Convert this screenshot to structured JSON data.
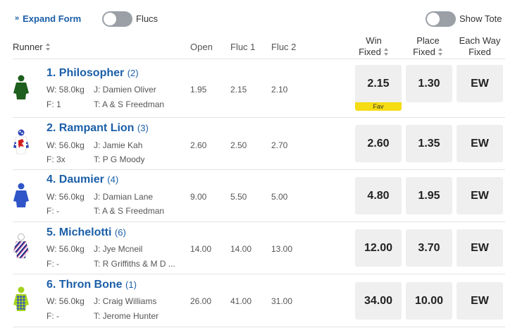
{
  "controls": {
    "expand_label": "Expand Form",
    "expand_icon": "double-chevron-down",
    "flucs_label": "Flucs",
    "flucs_on": false,
    "show_tote_label": "Show Tote",
    "show_tote_on": false
  },
  "header": {
    "runner": "Runner",
    "open": "Open",
    "fluc1": "Fluc 1",
    "fluc2": "Fluc 2",
    "win_line1": "Win",
    "win_line2": "Fixed",
    "place_line1": "Place",
    "place_line2": "Fixed",
    "ew_line1": "Each Way",
    "ew_line2": "Fixed"
  },
  "runners": [
    {
      "name": "1. Philosopher",
      "barrier": "(2)",
      "weight": "W: 58.0kg",
      "jockey": "J: Damien Oliver",
      "form": "F: 1",
      "trainer": "T: A & S Freedman",
      "open": "1.95",
      "fluc1": "2.15",
      "fluc2": "2.10",
      "win": "2.15",
      "place": "1.30",
      "ew": "EW",
      "fav": "Fav",
      "silk_colors": [
        "#1e5e1e",
        "#1e5e1e"
      ]
    },
    {
      "name": "2. Rampant Lion",
      "barrier": "(3)",
      "weight": "W: 56.0kg",
      "jockey": "J: Jamie Kah",
      "form": "F: 3x",
      "trainer": "T: P G Moody",
      "open": "2.60",
      "fluc1": "2.50",
      "fluc2": "2.70",
      "win": "2.60",
      "place": "1.35",
      "ew": "EW",
      "silk_colors": [
        "#2b45b8",
        "#ffffff",
        "#d01f1f"
      ]
    },
    {
      "name": "4. Daumier",
      "barrier": "(4)",
      "weight": "W: 56.0kg",
      "jockey": "J: Damian Lane",
      "form": "F: -",
      "trainer": "T: A & S Freedman",
      "open": "9.00",
      "fluc1": "5.50",
      "fluc2": "5.00",
      "win": "4.80",
      "place": "1.95",
      "ew": "EW",
      "silk_colors": [
        "#2f55c8",
        "#2f55c8"
      ]
    },
    {
      "name": "5. Michelotti",
      "barrier": "(6)",
      "weight": "W: 56.0kg",
      "jockey": "J: Jye Mcneil",
      "form": "F: -",
      "trainer": "T: R Griffiths & M D ...",
      "open": "14.00",
      "fluc1": "14.00",
      "fluc2": "13.00",
      "win": "12.00",
      "place": "3.70",
      "ew": "EW",
      "silk_colors": [
        "#ffffff",
        "#1c2f86",
        "#e06aa8"
      ]
    },
    {
      "name": "6. Thron Bone",
      "barrier": "(1)",
      "weight": "W: 56.0kg",
      "jockey": "J: Craig Williams",
      "form": "F: -",
      "trainer": "T: Jerome Hunter",
      "open": "26.00",
      "fluc1": "41.00",
      "fluc2": "31.00",
      "win": "34.00",
      "place": "10.00",
      "ew": "EW",
      "silk_colors": [
        "#a4d21c",
        "#3c5ab8"
      ]
    }
  ]
}
